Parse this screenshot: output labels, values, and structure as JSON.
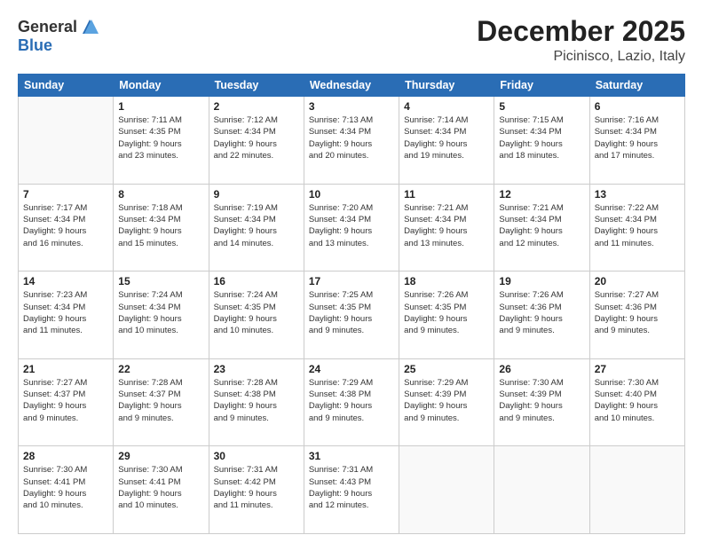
{
  "header": {
    "logo_general": "General",
    "logo_blue": "Blue",
    "month": "December 2025",
    "location": "Picinisco, Lazio, Italy"
  },
  "days_of_week": [
    "Sunday",
    "Monday",
    "Tuesday",
    "Wednesday",
    "Thursday",
    "Friday",
    "Saturday"
  ],
  "weeks": [
    [
      {
        "day": "",
        "info": ""
      },
      {
        "day": "1",
        "info": "Sunrise: 7:11 AM\nSunset: 4:35 PM\nDaylight: 9 hours\nand 23 minutes."
      },
      {
        "day": "2",
        "info": "Sunrise: 7:12 AM\nSunset: 4:34 PM\nDaylight: 9 hours\nand 22 minutes."
      },
      {
        "day": "3",
        "info": "Sunrise: 7:13 AM\nSunset: 4:34 PM\nDaylight: 9 hours\nand 20 minutes."
      },
      {
        "day": "4",
        "info": "Sunrise: 7:14 AM\nSunset: 4:34 PM\nDaylight: 9 hours\nand 19 minutes."
      },
      {
        "day": "5",
        "info": "Sunrise: 7:15 AM\nSunset: 4:34 PM\nDaylight: 9 hours\nand 18 minutes."
      },
      {
        "day": "6",
        "info": "Sunrise: 7:16 AM\nSunset: 4:34 PM\nDaylight: 9 hours\nand 17 minutes."
      }
    ],
    [
      {
        "day": "7",
        "info": "Sunrise: 7:17 AM\nSunset: 4:34 PM\nDaylight: 9 hours\nand 16 minutes."
      },
      {
        "day": "8",
        "info": "Sunrise: 7:18 AM\nSunset: 4:34 PM\nDaylight: 9 hours\nand 15 minutes."
      },
      {
        "day": "9",
        "info": "Sunrise: 7:19 AM\nSunset: 4:34 PM\nDaylight: 9 hours\nand 14 minutes."
      },
      {
        "day": "10",
        "info": "Sunrise: 7:20 AM\nSunset: 4:34 PM\nDaylight: 9 hours\nand 13 minutes."
      },
      {
        "day": "11",
        "info": "Sunrise: 7:21 AM\nSunset: 4:34 PM\nDaylight: 9 hours\nand 13 minutes."
      },
      {
        "day": "12",
        "info": "Sunrise: 7:21 AM\nSunset: 4:34 PM\nDaylight: 9 hours\nand 12 minutes."
      },
      {
        "day": "13",
        "info": "Sunrise: 7:22 AM\nSunset: 4:34 PM\nDaylight: 9 hours\nand 11 minutes."
      }
    ],
    [
      {
        "day": "14",
        "info": "Sunrise: 7:23 AM\nSunset: 4:34 PM\nDaylight: 9 hours\nand 11 minutes."
      },
      {
        "day": "15",
        "info": "Sunrise: 7:24 AM\nSunset: 4:34 PM\nDaylight: 9 hours\nand 10 minutes."
      },
      {
        "day": "16",
        "info": "Sunrise: 7:24 AM\nSunset: 4:35 PM\nDaylight: 9 hours\nand 10 minutes."
      },
      {
        "day": "17",
        "info": "Sunrise: 7:25 AM\nSunset: 4:35 PM\nDaylight: 9 hours\nand 9 minutes."
      },
      {
        "day": "18",
        "info": "Sunrise: 7:26 AM\nSunset: 4:35 PM\nDaylight: 9 hours\nand 9 minutes."
      },
      {
        "day": "19",
        "info": "Sunrise: 7:26 AM\nSunset: 4:36 PM\nDaylight: 9 hours\nand 9 minutes."
      },
      {
        "day": "20",
        "info": "Sunrise: 7:27 AM\nSunset: 4:36 PM\nDaylight: 9 hours\nand 9 minutes."
      }
    ],
    [
      {
        "day": "21",
        "info": "Sunrise: 7:27 AM\nSunset: 4:37 PM\nDaylight: 9 hours\nand 9 minutes."
      },
      {
        "day": "22",
        "info": "Sunrise: 7:28 AM\nSunset: 4:37 PM\nDaylight: 9 hours\nand 9 minutes."
      },
      {
        "day": "23",
        "info": "Sunrise: 7:28 AM\nSunset: 4:38 PM\nDaylight: 9 hours\nand 9 minutes."
      },
      {
        "day": "24",
        "info": "Sunrise: 7:29 AM\nSunset: 4:38 PM\nDaylight: 9 hours\nand 9 minutes."
      },
      {
        "day": "25",
        "info": "Sunrise: 7:29 AM\nSunset: 4:39 PM\nDaylight: 9 hours\nand 9 minutes."
      },
      {
        "day": "26",
        "info": "Sunrise: 7:30 AM\nSunset: 4:39 PM\nDaylight: 9 hours\nand 9 minutes."
      },
      {
        "day": "27",
        "info": "Sunrise: 7:30 AM\nSunset: 4:40 PM\nDaylight: 9 hours\nand 10 minutes."
      }
    ],
    [
      {
        "day": "28",
        "info": "Sunrise: 7:30 AM\nSunset: 4:41 PM\nDaylight: 9 hours\nand 10 minutes."
      },
      {
        "day": "29",
        "info": "Sunrise: 7:30 AM\nSunset: 4:41 PM\nDaylight: 9 hours\nand 10 minutes."
      },
      {
        "day": "30",
        "info": "Sunrise: 7:31 AM\nSunset: 4:42 PM\nDaylight: 9 hours\nand 11 minutes."
      },
      {
        "day": "31",
        "info": "Sunrise: 7:31 AM\nSunset: 4:43 PM\nDaylight: 9 hours\nand 12 minutes."
      },
      {
        "day": "",
        "info": ""
      },
      {
        "day": "",
        "info": ""
      },
      {
        "day": "",
        "info": ""
      }
    ]
  ]
}
